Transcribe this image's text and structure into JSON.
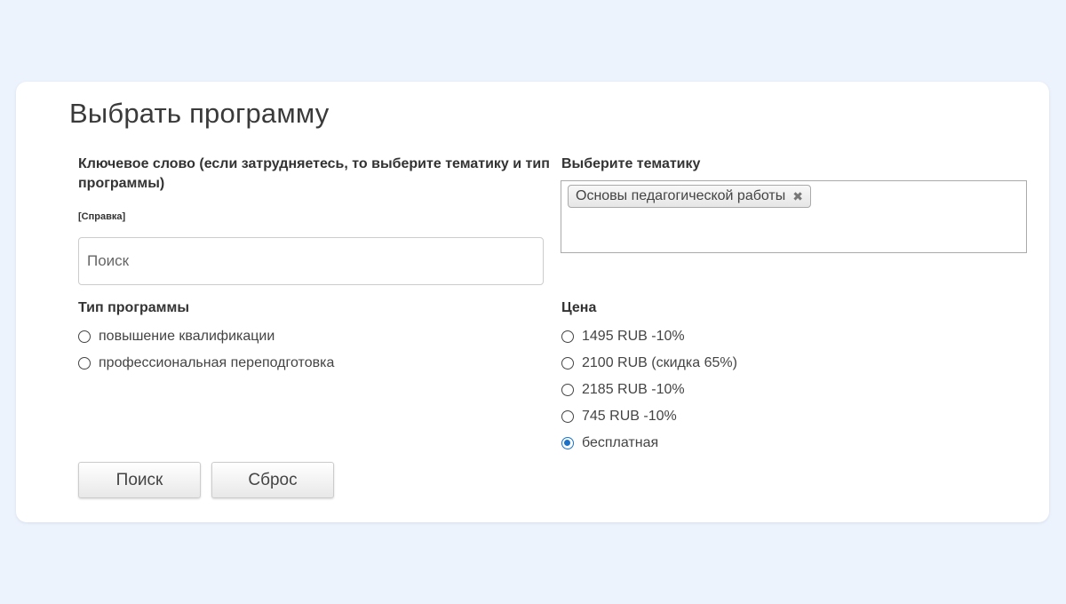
{
  "form": {
    "title": "Выбрать программу",
    "keyword": {
      "label": "Ключевое слово (если затрудняетесь, то выберите тематику и тип программы)",
      "help_link": "[Справка]",
      "placeholder": "Поиск",
      "value": ""
    },
    "topic": {
      "label": "Выберите тематику",
      "selected": [
        "Основы педагогической работы"
      ],
      "remove_glyph": "✖"
    },
    "program_type": {
      "label": "Тип программы",
      "options": [
        {
          "label": "повышение квалификации",
          "checked": false
        },
        {
          "label": "профессиональная переподготовка",
          "checked": false
        }
      ]
    },
    "price": {
      "label": "Цена",
      "options": [
        {
          "label": "1495 RUB -10%",
          "checked": false
        },
        {
          "label": "2100 RUB (скидка 65%)",
          "checked": false
        },
        {
          "label": "2185 RUB -10%",
          "checked": false
        },
        {
          "label": "745 RUB -10%",
          "checked": false
        },
        {
          "label": "бесплатная",
          "checked": true
        }
      ]
    },
    "buttons": {
      "search": "Поиск",
      "reset": "Сброс"
    }
  },
  "colors": {
    "background": "#edf3fc",
    "card": "#ffffff",
    "accent": "#1a73c9",
    "text": "#333333"
  }
}
